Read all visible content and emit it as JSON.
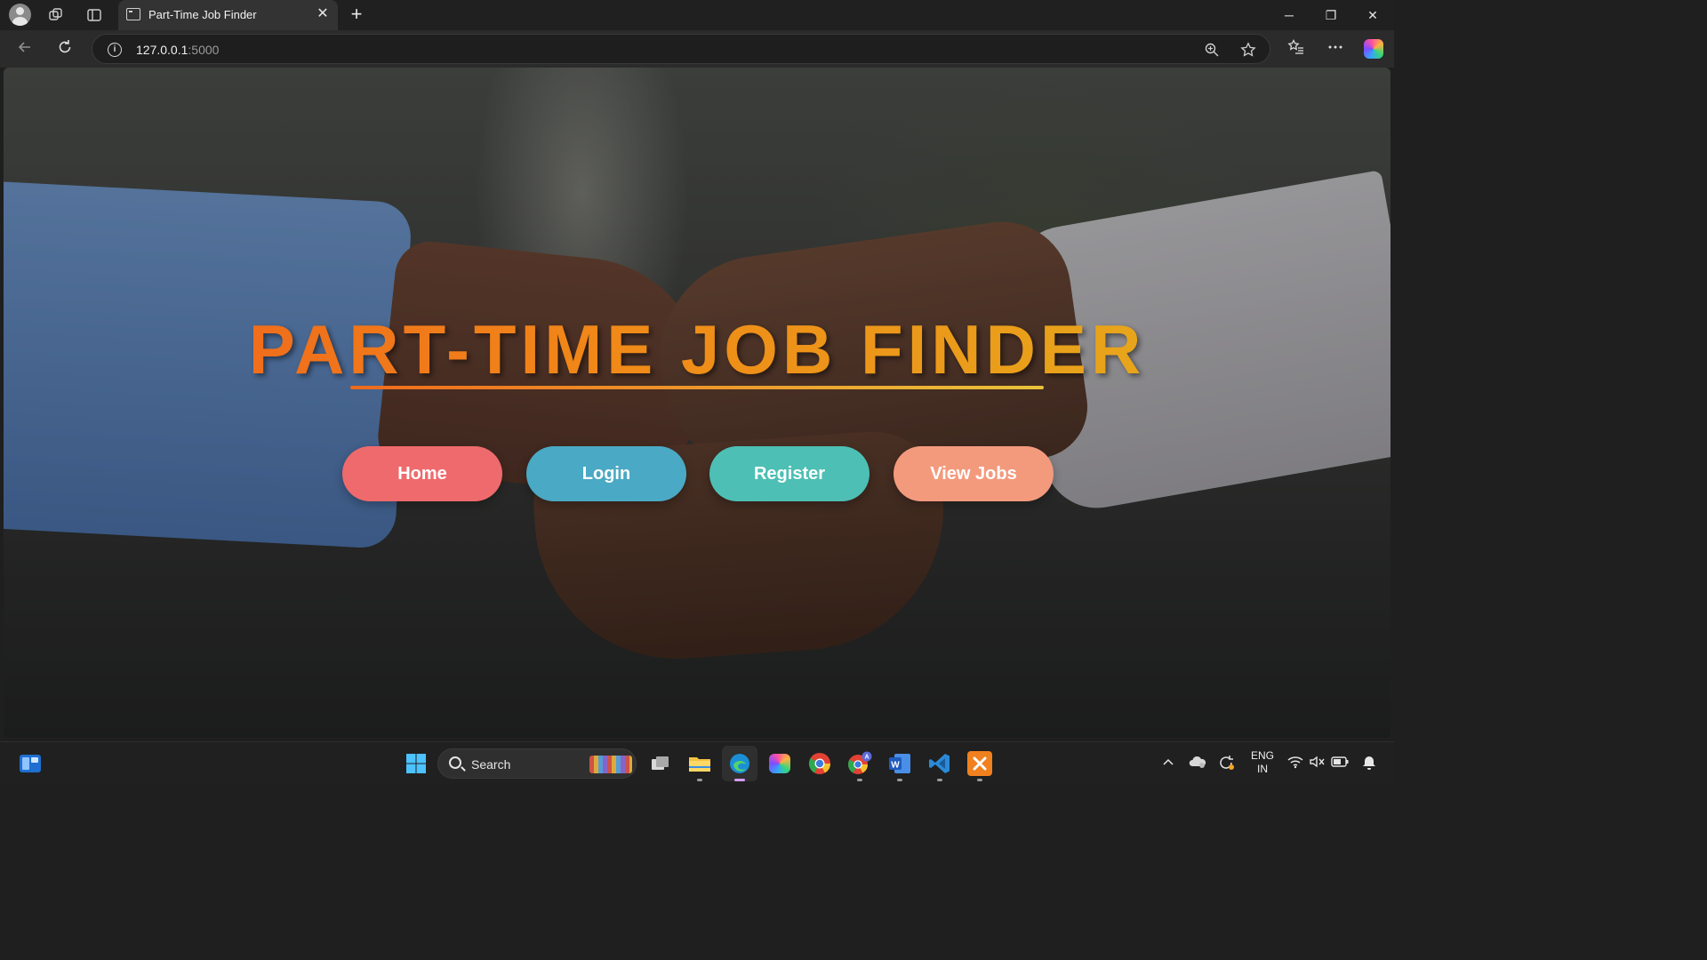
{
  "browser": {
    "tab_title": "Part-Time Job Finder",
    "tab_close": "✕",
    "new_tab": "+",
    "url_host": "127.0.0.1",
    "url_port": ":5000",
    "window_controls": {
      "minimize": "─",
      "maximize": "❐",
      "close": "✕"
    }
  },
  "page": {
    "title": "PART-TIME JOB FINDER",
    "title_gradient": [
      "#ef5b1e",
      "#f08a18",
      "#e3b21c"
    ],
    "nav": [
      {
        "label": "Home",
        "color": "#ef6a6c"
      },
      {
        "label": "Login",
        "color": "#4aa9c4"
      },
      {
        "label": "Register",
        "color": "#4dbfb4"
      },
      {
        "label": "View Jobs",
        "color": "#f39a7d"
      }
    ]
  },
  "taskbar": {
    "search_label": "Search",
    "language": {
      "line1": "ENG",
      "line2": "IN"
    },
    "apps": [
      "windows-start-icon",
      "task-view-icon",
      "file-explorer-icon",
      "edge-icon",
      "copilot-icon",
      "chrome-icon",
      "chrome-profile-icon",
      "word-icon",
      "vscode-icon",
      "xampp-icon"
    ]
  }
}
